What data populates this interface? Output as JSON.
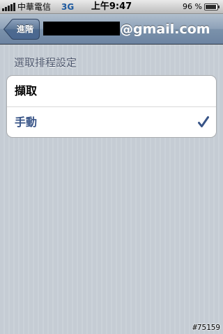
{
  "status_bar": {
    "carrier": "中華電信",
    "network": "3G",
    "time": "上午9:47",
    "battery": "96 %",
    "battery_level": 0.96,
    "signal_icon": "signal-bars-icon",
    "battery_icon": "battery-icon"
  },
  "nav_bar": {
    "back_label": "進階",
    "title_suffix": "@gmail.com"
  },
  "section": {
    "header": "選取排程設定"
  },
  "options": [
    {
      "label": "擷取",
      "selected": false
    },
    {
      "label": "手動",
      "selected": true
    }
  ],
  "watermark": "#75159",
  "colors": {
    "nav_bar": "#6d84a2",
    "background": "#c5ccd4",
    "checkmark": "#385487"
  }
}
